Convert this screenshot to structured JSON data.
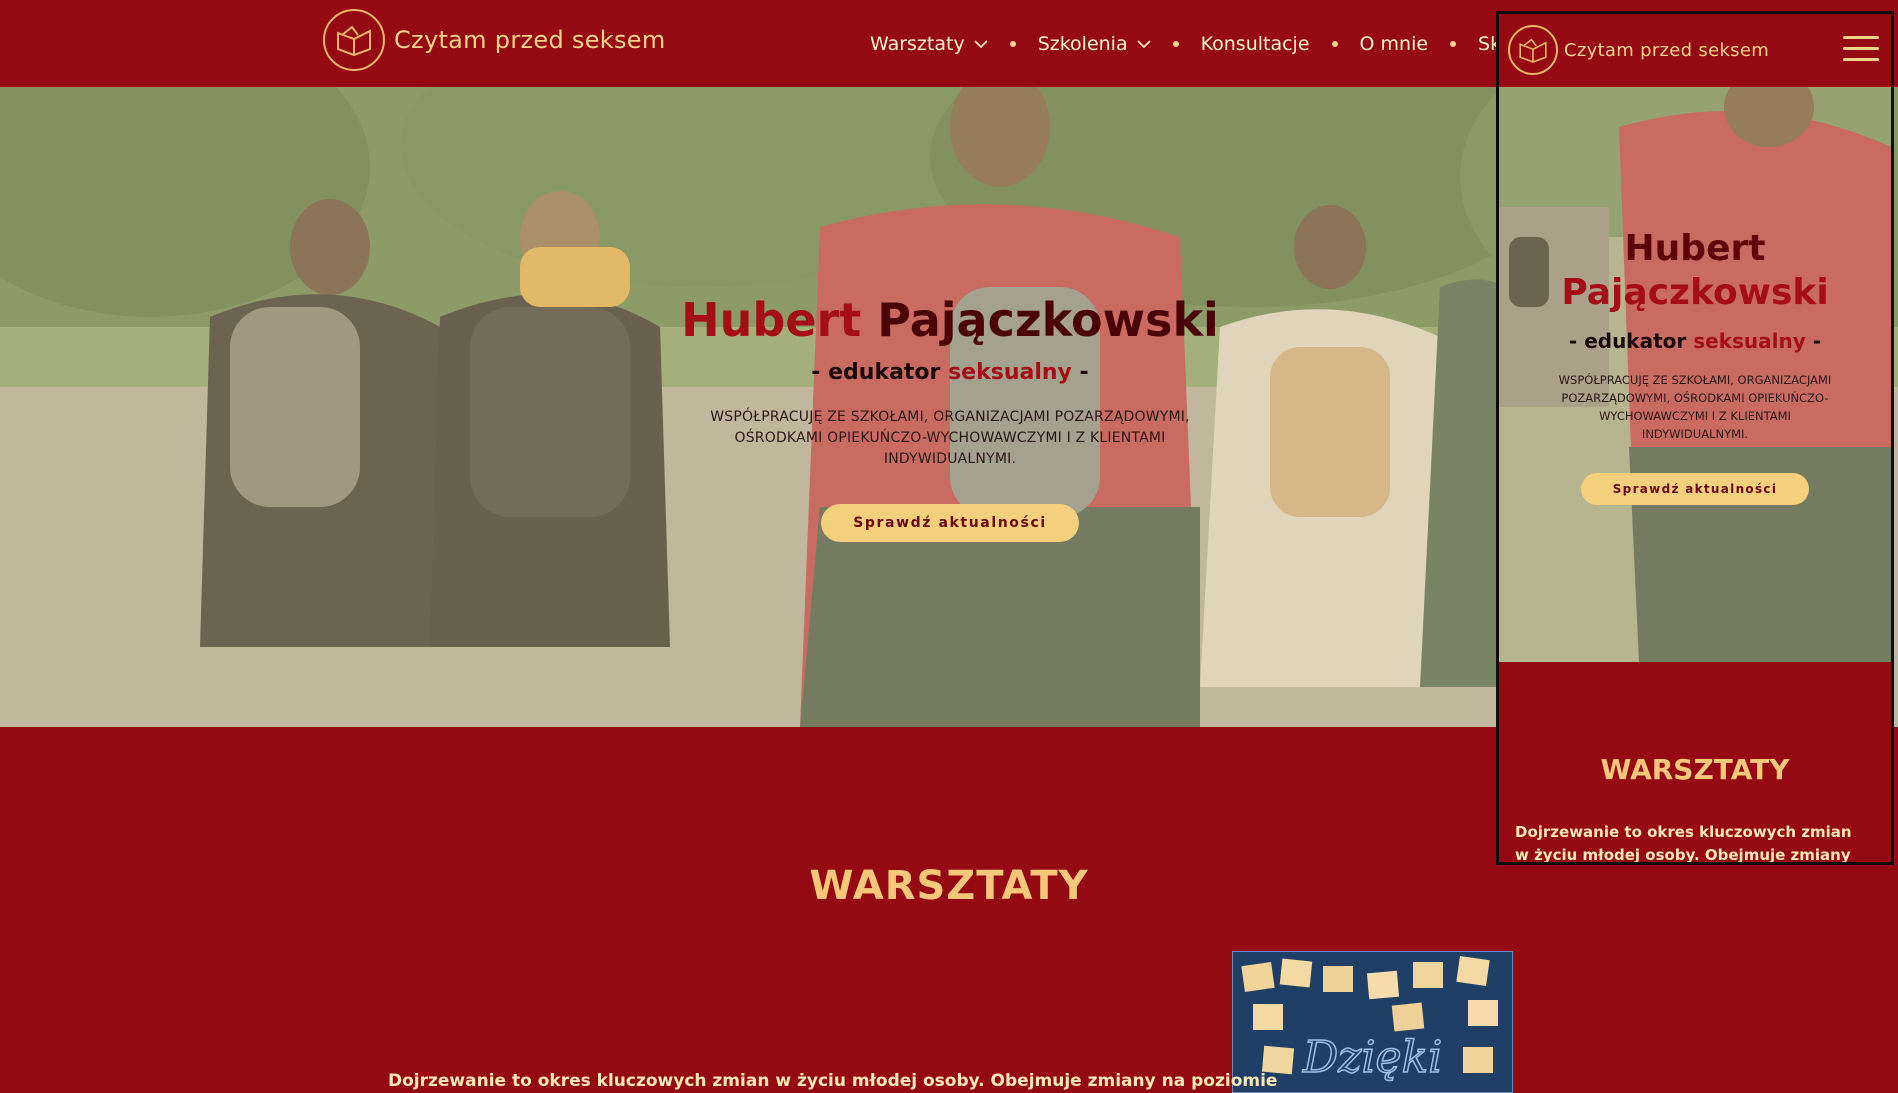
{
  "brand": {
    "name": "Czytam przed seksem",
    "logo_icon": "open-book-icon",
    "primary_color": "#950a12",
    "accent_color": "#f4cf7c"
  },
  "nav": {
    "items": [
      {
        "label": "Warsztaty",
        "has_dropdown": true
      },
      {
        "label": "Szkolenia",
        "has_dropdown": true
      },
      {
        "label": "Konsultacje",
        "has_dropdown": false
      },
      {
        "label": "O mnie",
        "has_dropdown": false
      },
      {
        "label": "Skont",
        "has_dropdown": false
      }
    ]
  },
  "hero": {
    "name_first": "Hubert",
    "name_last": "Pajączkowski",
    "subtitle_prefix": "-",
    "subtitle_main": "edukator",
    "subtitle_accent": "seksualny",
    "subtitle_suffix": "-",
    "description": "WSPÓŁPRACUJĘ ZE SZKOŁAMI, ORGANIZACJAMI POZARZĄDOWYMI, OŚRODKAMI OPIEKUŃCZO-WYCHOWAWCZYMI I Z KLIENTAMI INDYWIDUALNYMI.",
    "cta_label": "Sprawdź aktualności"
  },
  "workshops": {
    "title": "WARSZTATY",
    "intro_desktop": "Dojrzewanie to okres kluczowych zmian w życiu młodej osoby. Obejmuje zmiany na poziomie",
    "intro_mobile": "Dojrzewanie to okres kluczowych zmian w życiu młodej osoby. Obejmuje zmiany na",
    "photo_text": "Dzięki"
  },
  "mobile_preview": {
    "menu_icon": "hamburger-menu-icon"
  }
}
